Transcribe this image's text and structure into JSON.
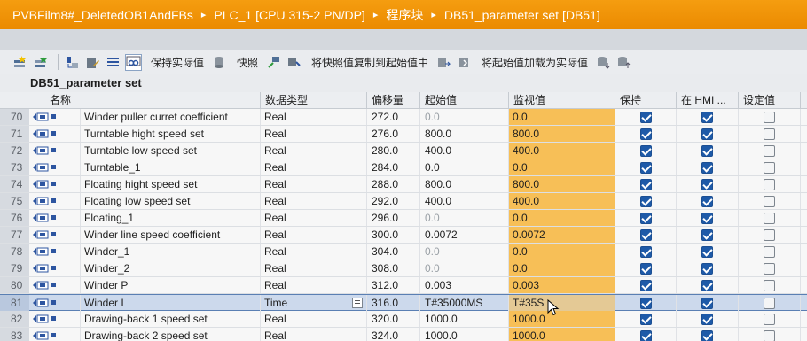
{
  "breadcrumb": {
    "items": [
      "PVBFilm8#_DeletedOB1AndFBs",
      "PLC_1 [CPU 315-2 PN/DP]",
      "程序块",
      "DB51_parameter set [DB51]"
    ],
    "separator": "▸"
  },
  "toolbar": {
    "keep_actual_label": "保持实际值",
    "snapshot_label": "快照",
    "copy_snapshot_label": "将快照值复制到起始值中",
    "load_start_label": "将起始值加载为实际值",
    "icons": [
      "add-row-icon",
      "insert-row-icon",
      "expand-icon",
      "edit-icon",
      "list-icon",
      "monitor-glasses-icon",
      "db-snapshot-icon",
      "snapshot-icon",
      "pin-icon",
      "db-copy-icon",
      "db-load-icon",
      "db-download-icon"
    ]
  },
  "block_title": "DB51_parameter set",
  "columns": {
    "name": "名称",
    "datatype": "数据类型",
    "offset": "偏移量",
    "start": "起始值",
    "monitor": "监视值",
    "retain": "保持",
    "hmi": "在 HMI ...",
    "setpoint": "设定值"
  },
  "rows": [
    {
      "num": "70",
      "name": "Winder puller curret coefficient",
      "type": "Real",
      "offset": "272.0",
      "start": "0.0",
      "start_grey": true,
      "monitor": "0.0",
      "retain": true,
      "hmi": true,
      "setpoint": false
    },
    {
      "num": "71",
      "name": "Turntable hight speed set",
      "type": "Real",
      "offset": "276.0",
      "start": "800.0",
      "start_grey": false,
      "monitor": "800.0",
      "retain": true,
      "hmi": true,
      "setpoint": false
    },
    {
      "num": "72",
      "name": "Turntable low speed set",
      "type": "Real",
      "offset": "280.0",
      "start": "400.0",
      "start_grey": false,
      "monitor": "400.0",
      "retain": true,
      "hmi": true,
      "setpoint": false
    },
    {
      "num": "73",
      "name": "Turntable_1",
      "type": "Real",
      "offset": "284.0",
      "start": "0.0",
      "start_grey": false,
      "monitor": "0.0",
      "retain": true,
      "hmi": true,
      "setpoint": false
    },
    {
      "num": "74",
      "name": "Floating hight speed set",
      "type": "Real",
      "offset": "288.0",
      "start": "800.0",
      "start_grey": false,
      "monitor": "800.0",
      "retain": true,
      "hmi": true,
      "setpoint": false
    },
    {
      "num": "75",
      "name": "Floating low speed set",
      "type": "Real",
      "offset": "292.0",
      "start": "400.0",
      "start_grey": false,
      "monitor": "400.0",
      "retain": true,
      "hmi": true,
      "setpoint": false
    },
    {
      "num": "76",
      "name": "Floating_1",
      "type": "Real",
      "offset": "296.0",
      "start": "0.0",
      "start_grey": true,
      "monitor": "0.0",
      "retain": true,
      "hmi": true,
      "setpoint": false
    },
    {
      "num": "77",
      "name": "Winder line speed coefficient",
      "type": "Real",
      "offset": "300.0",
      "start": "0.0072",
      "start_grey": false,
      "monitor": "0.0072",
      "retain": true,
      "hmi": true,
      "setpoint": false
    },
    {
      "num": "78",
      "name": "Winder_1",
      "type": "Real",
      "offset": "304.0",
      "start": "0.0",
      "start_grey": true,
      "monitor": "0.0",
      "retain": true,
      "hmi": true,
      "setpoint": false
    },
    {
      "num": "79",
      "name": "Winder_2",
      "type": "Real",
      "offset": "308.0",
      "start": "0.0",
      "start_grey": true,
      "monitor": "0.0",
      "retain": true,
      "hmi": true,
      "setpoint": false
    },
    {
      "num": "80",
      "name": "Winder P",
      "type": "Real",
      "offset": "312.0",
      "start": "0.003",
      "start_grey": false,
      "monitor": "0.003",
      "retain": true,
      "hmi": true,
      "setpoint": false
    },
    {
      "num": "81",
      "name": "Winder I",
      "type": "Time",
      "offset": "316.0",
      "start": "T#35000MS",
      "start_grey": false,
      "monitor": "T#35S",
      "retain": true,
      "hmi": true,
      "setpoint": false,
      "selected": true
    },
    {
      "num": "82",
      "name": "Drawing-back 1 speed set",
      "type": "Real",
      "offset": "320.0",
      "start": "1000.0",
      "start_grey": false,
      "monitor": "1000.0",
      "retain": true,
      "hmi": true,
      "setpoint": false
    },
    {
      "num": "83",
      "name": "Drawing-back 2 speed set",
      "type": "Real",
      "offset": "324.0",
      "start": "1000.0",
      "start_grey": false,
      "monitor": "1000.0",
      "retain": true,
      "hmi": true,
      "setpoint": false
    }
  ],
  "colors": {
    "breadcrumb_bg": "#f0940a",
    "monitor_bg": "#f7bf57",
    "checkbox_on": "#1e5aa8",
    "selection": "#ccd9ec"
  }
}
